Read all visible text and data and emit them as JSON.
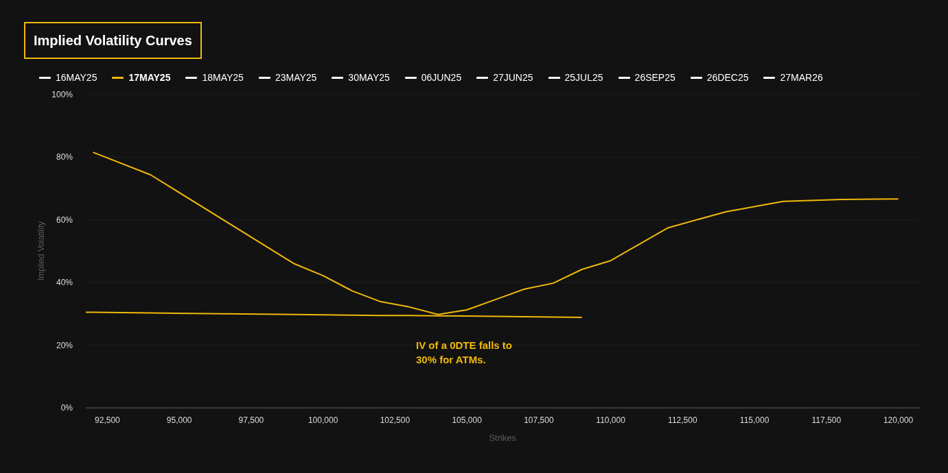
{
  "title": "Implied Volatility Curves",
  "legend": [
    {
      "label": "16MAY25",
      "selected": false,
      "color": "#ffffff"
    },
    {
      "kind": "series",
      "selected": true
    },
    {
      "label": "18MAY25",
      "selected": false,
      "color": "#ffffff"
    },
    {
      "label": "23MAY25",
      "selected": false,
      "color": "#ffffff"
    },
    {
      "label": "30MAY25",
      "selected": false,
      "color": "#ffffff"
    },
    {
      "label": "06JUN25",
      "selected": false,
      "color": "#ffffff"
    },
    {
      "label": "27JUN25",
      "selected": false,
      "color": "#ffffff"
    },
    {
      "label": "25JUL25",
      "selected": false,
      "color": "#ffffff"
    },
    {
      "label": "26SEP25",
      "selected": false,
      "color": "#ffffff"
    },
    {
      "label": "26DEC25",
      "selected": false,
      "color": "#ffffff"
    },
    {
      "label": "27MAR26",
      "selected": false,
      "color": "#ffffff"
    }
  ],
  "chart_data": {
    "type": "line",
    "xlabel": "Strikes",
    "ylabel": "Implied Volatility",
    "xlim": [
      91750,
      120750
    ],
    "ylim": [
      0,
      100
    ],
    "xticks": [
      {
        "value": 92500,
        "label": "92,500"
      },
      {
        "value": 95000,
        "label": "95,000"
      },
      {
        "value": 97500,
        "label": "97,500"
      },
      {
        "value": 100000,
        "label": "100,000"
      },
      {
        "value": 102500,
        "label": "102,500"
      },
      {
        "value": 105000,
        "label": "105,000"
      },
      {
        "value": 107500,
        "label": "107,500"
      },
      {
        "value": 110000,
        "label": "110,000"
      },
      {
        "value": 112500,
        "label": "112,500"
      },
      {
        "value": 115000,
        "label": "115,000"
      },
      {
        "value": 117500,
        "label": "117,500"
      },
      {
        "value": 120000,
        "label": "120,000"
      }
    ],
    "yticks": [
      {
        "value": 0,
        "label": "0%"
      },
      {
        "value": 20,
        "label": "20%"
      },
      {
        "value": 40,
        "label": "40%"
      },
      {
        "value": 60,
        "label": "60%"
      },
      {
        "value": 80,
        "label": "80%"
      },
      {
        "value": 100,
        "label": "100%"
      }
    ],
    "x": [
      91750,
      92000,
      94000,
      99000,
      100000,
      101000,
      102000,
      103000,
      104000,
      105000,
      106000,
      107000,
      108000,
      109000,
      110000,
      112000,
      114000,
      116000,
      118000,
      120000
    ],
    "series": [
      {
        "name": "17MAY25",
        "color": "#f0b90b",
        "values": [
          null,
          81.6,
          74.4,
          46.0,
          42.2,
          37.4,
          33.9,
          32.2,
          29.8,
          31.3,
          34.6,
          37.9,
          39.8,
          44.2,
          47.0,
          57.5,
          62.6,
          65.9,
          66.5,
          66.7
        ]
      },
      {
        "color": "#f0b90b",
        "values": [
          30.5,
          30.5,
          30.3,
          29.8,
          29.7,
          29.6,
          29.5,
          29.5,
          29.4,
          29.3,
          29.2,
          29.1,
          29.0,
          28.9,
          null,
          null,
          null,
          null,
          null,
          null
        ]
      }
    ],
    "grid": true,
    "annotations": [
      {
        "text": "IV of a 0DTE falls to 30% for ATMs."
      }
    ]
  }
}
